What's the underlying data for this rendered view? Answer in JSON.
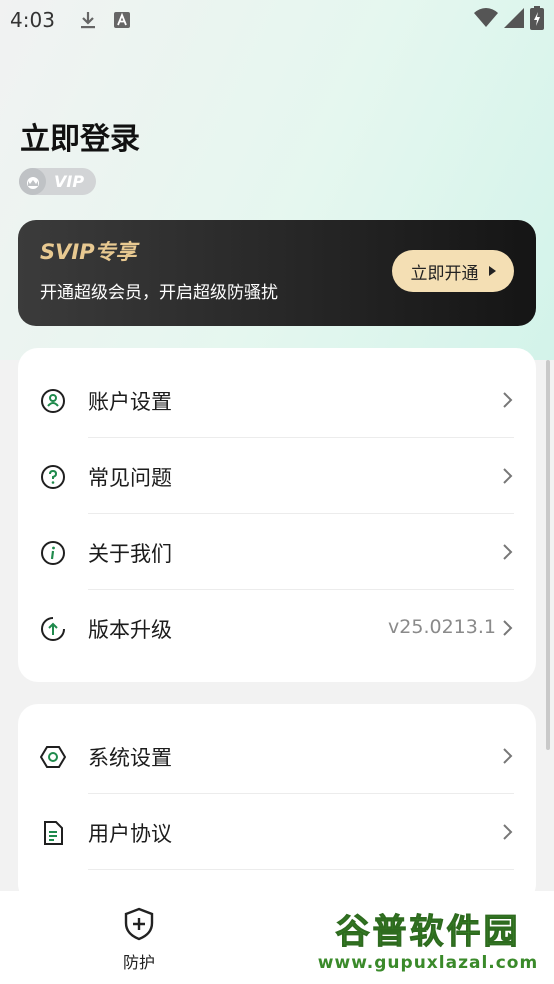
{
  "status_bar": {
    "time": "4:03",
    "icons": [
      "download-icon",
      "a-box-icon",
      "wifi-icon",
      "signal-icon",
      "battery-charging-icon"
    ]
  },
  "header": {
    "login_title": "立即登录",
    "vip_badge": "VIP"
  },
  "svip_card": {
    "title": "SVIP专享",
    "description": "开通超级会员，开启超级防骚扰",
    "button_label": "立即开通",
    "colors": {
      "title": "#e8c991",
      "button_bg": "#f4dfb4"
    }
  },
  "menu_group_1": [
    {
      "label": "账户设置",
      "icon": "account-icon"
    },
    {
      "label": "常见问题",
      "icon": "question-icon"
    },
    {
      "label": "关于我们",
      "icon": "info-icon"
    },
    {
      "label": "版本升级",
      "icon": "upgrade-icon",
      "value": "v25.0213.1"
    }
  ],
  "menu_group_2": [
    {
      "label": "系统设置",
      "icon": "settings-hexagon-icon"
    },
    {
      "label": "用户协议",
      "icon": "document-icon"
    }
  ],
  "bottom_nav": {
    "protect_label": "防护"
  },
  "watermark": {
    "title": "谷普软件园",
    "url": "www.gupuxlazal.com"
  },
  "accent_color": "#1f8a4c"
}
